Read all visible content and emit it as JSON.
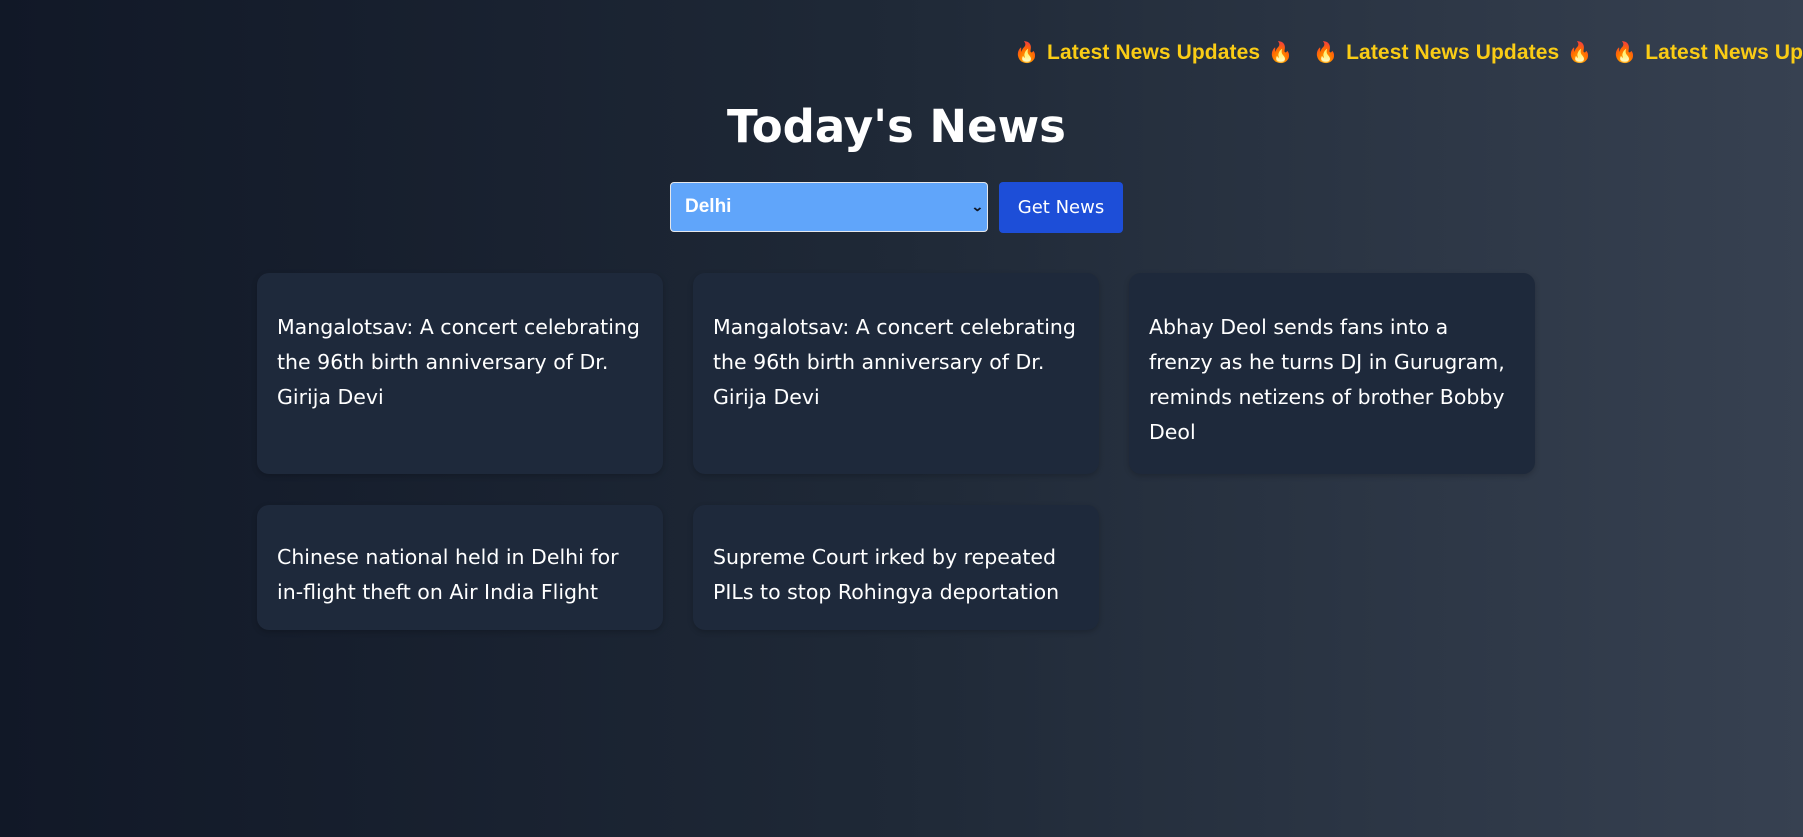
{
  "ticker": {
    "items": [
      "Latest News Updates",
      "Latest News Updates",
      "Latest News Updates"
    ],
    "icon": "flame-icon"
  },
  "page_title": "Today's News",
  "controls": {
    "city_select_value": "Delhi",
    "get_news_label": "Get News"
  },
  "news": [
    {
      "headline": "Mangalotsav: A concert celebrating the 96th birth anniversary of Dr. Girija Devi"
    },
    {
      "headline": "Mangalotsav: A concert celebrating the 96th birth anniversary of Dr. Girija Devi"
    },
    {
      "headline": "Abhay Deol sends fans into a frenzy as he turns DJ in Gurugram, reminds netizens of brother Bobby Deol"
    },
    {
      "headline": "Chinese national held in Delhi for in-flight theft on Air India Flight"
    },
    {
      "headline": "Supreme Court irked by repeated PILs to stop Rohingya deportation"
    }
  ],
  "colors": {
    "ticker_text": "#facc15",
    "select_bg": "#60a5fa",
    "button_bg": "#1d4ed8",
    "card_bg": "#1e293b"
  }
}
